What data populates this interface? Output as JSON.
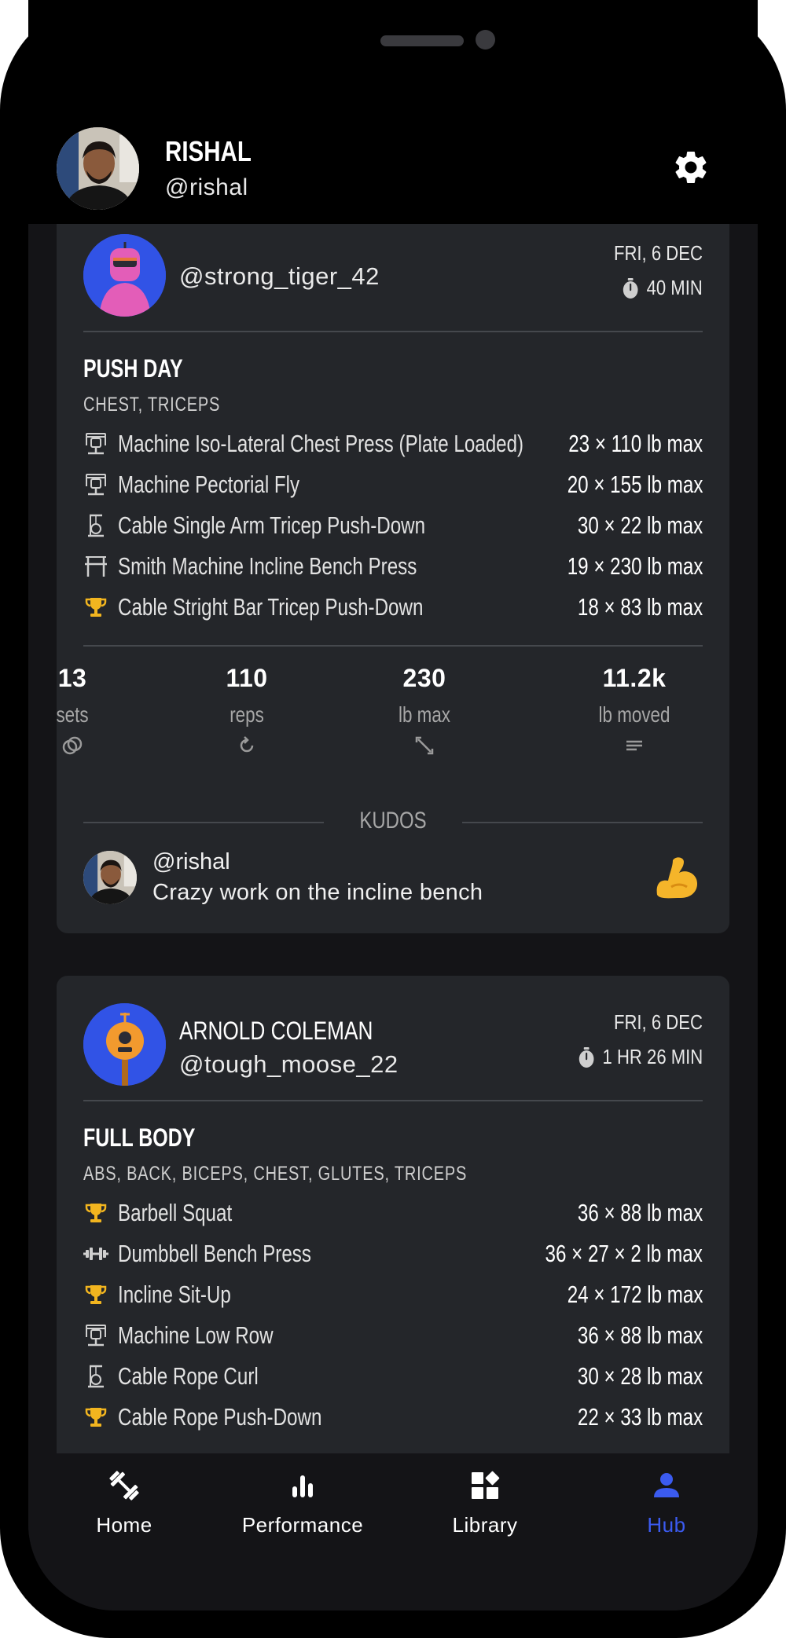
{
  "profile": {
    "name": "RISHAL",
    "handle": "@rishal"
  },
  "colors": {
    "accent": "#3b5bf0",
    "trophy": "#f2b51f",
    "card": "#24262a",
    "background": "#141417"
  },
  "posts": [
    {
      "user": "@strong_tiger_42",
      "full_name": "",
      "date": "FRI, 6 DEC",
      "duration": "40 MIN",
      "workout_title": "PUSH DAY",
      "muscles": "CHEST, TRICEPS",
      "exercises": [
        {
          "icon": "machine-icon",
          "name": "Machine Iso-Lateral Chest Press (Plate Loaded)",
          "value": "23 × 110 lb max"
        },
        {
          "icon": "machine-icon",
          "name": "Machine Pectorial Fly",
          "value": "20 × 155 lb max"
        },
        {
          "icon": "cable-icon",
          "name": "Cable Single Arm Tricep Push-Down",
          "value": "30 × 22 lb max"
        },
        {
          "icon": "smith-machine-icon",
          "name": "Smith Machine Incline Bench Press",
          "value": "19 × 230 lb max"
        },
        {
          "icon": "trophy-icon",
          "name": "Cable Stright Bar Tricep Push-Down",
          "value": "18 × 83 lb max"
        }
      ],
      "stats": [
        {
          "value": "13",
          "label": "sets",
          "icon": "rings-icon"
        },
        {
          "value": "110",
          "label": "reps",
          "icon": "repeat-icon"
        },
        {
          "value": "230",
          "label": "lb max",
          "icon": "expand-icon"
        },
        {
          "value": "11.2k",
          "label": "lb moved",
          "icon": "lines-icon"
        }
      ],
      "kudos_label": "KUDOS",
      "kudos": {
        "user": "@rishal",
        "text": "Crazy work on the incline bench",
        "emoji": "flexed-biceps-icon"
      }
    },
    {
      "user": "@tough_moose_22",
      "full_name": "ARNOLD COLEMAN",
      "date": "FRI, 6 DEC",
      "duration": "1 HR 26 MIN",
      "workout_title": "FULL BODY",
      "muscles": "ABS, BACK, BICEPS, CHEST, GLUTES, TRICEPS",
      "exercises": [
        {
          "icon": "trophy-icon",
          "name": "Barbell Squat",
          "value": "36 × 88 lb max"
        },
        {
          "icon": "dumbbell-icon",
          "name": "Dumbbell Bench Press",
          "value": "36 × 27 × 2 lb max"
        },
        {
          "icon": "trophy-icon",
          "name": "Incline Sit-Up",
          "value": "24 × 172 lb max"
        },
        {
          "icon": "machine-icon",
          "name": "Machine Low Row",
          "value": "36 × 88 lb max"
        },
        {
          "icon": "cable-icon",
          "name": "Cable Rope Curl",
          "value": "30 × 28 lb max"
        },
        {
          "icon": "trophy-icon",
          "name": "Cable Rope Push-Down",
          "value": "22 × 33 lb max"
        }
      ]
    }
  ],
  "nav": [
    {
      "label": "Home",
      "icon": "dumbbell-diagonal-icon",
      "active": false
    },
    {
      "label": "Performance",
      "icon": "bar-chart-icon",
      "active": false
    },
    {
      "label": "Library",
      "icon": "widgets-icon",
      "active": false
    },
    {
      "label": "Hub",
      "icon": "person-icon",
      "active": true
    }
  ]
}
